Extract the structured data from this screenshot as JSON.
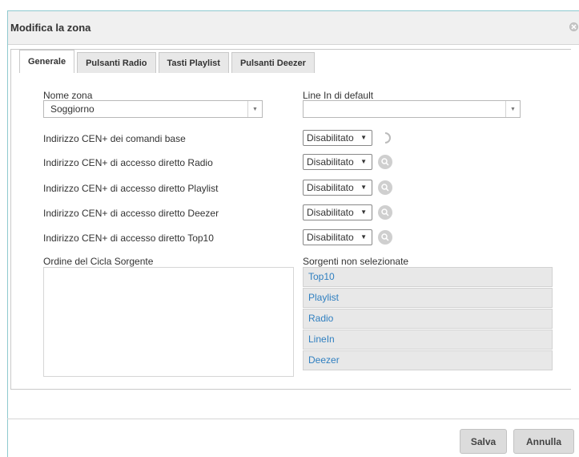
{
  "dialog": {
    "title": "Modifica la zona",
    "close_icon": "close-icon"
  },
  "tabs": [
    {
      "label": "Generale",
      "active": true
    },
    {
      "label": "Pulsanti Radio",
      "active": false
    },
    {
      "label": "Tasti Playlist",
      "active": false
    },
    {
      "label": "Pulsanti Deezer",
      "active": false
    }
  ],
  "form": {
    "zone_name_label": "Nome zona",
    "zone_name_value": "Soggiorno",
    "line_in_label": "Line In di default",
    "line_in_value": "",
    "rows": [
      {
        "label": "Indirizzo CEN+ dei comandi base",
        "value": "Disabilitato",
        "icon": "loading-spinner-icon"
      },
      {
        "label": "Indirizzo CEN+ di accesso diretto Radio",
        "value": "Disabilitato",
        "icon": "search-icon"
      },
      {
        "label": "Indirizzo CEN+ di accesso diretto Playlist",
        "value": "Disabilitato",
        "icon": "search-icon"
      },
      {
        "label": "Indirizzo CEN+ di accesso diretto Deezer",
        "value": "Disabilitato",
        "icon": "search-icon"
      },
      {
        "label": "Indirizzo CEN+ di accesso diretto Top10",
        "value": "Disabilitato",
        "icon": "search-icon"
      }
    ],
    "source_order_label": "Ordine del Cicla Sorgente",
    "unselected_sources_label": "Sorgenti non selezionate",
    "unselected_sources": [
      "Top10",
      "Playlist",
      "Radio",
      "LineIn",
      "Deezer"
    ]
  },
  "footer": {
    "save_label": "Salva",
    "cancel_label": "Annulla"
  },
  "colors": {
    "link": "#2f7fc0",
    "accent_border": "#8fc9cf"
  }
}
